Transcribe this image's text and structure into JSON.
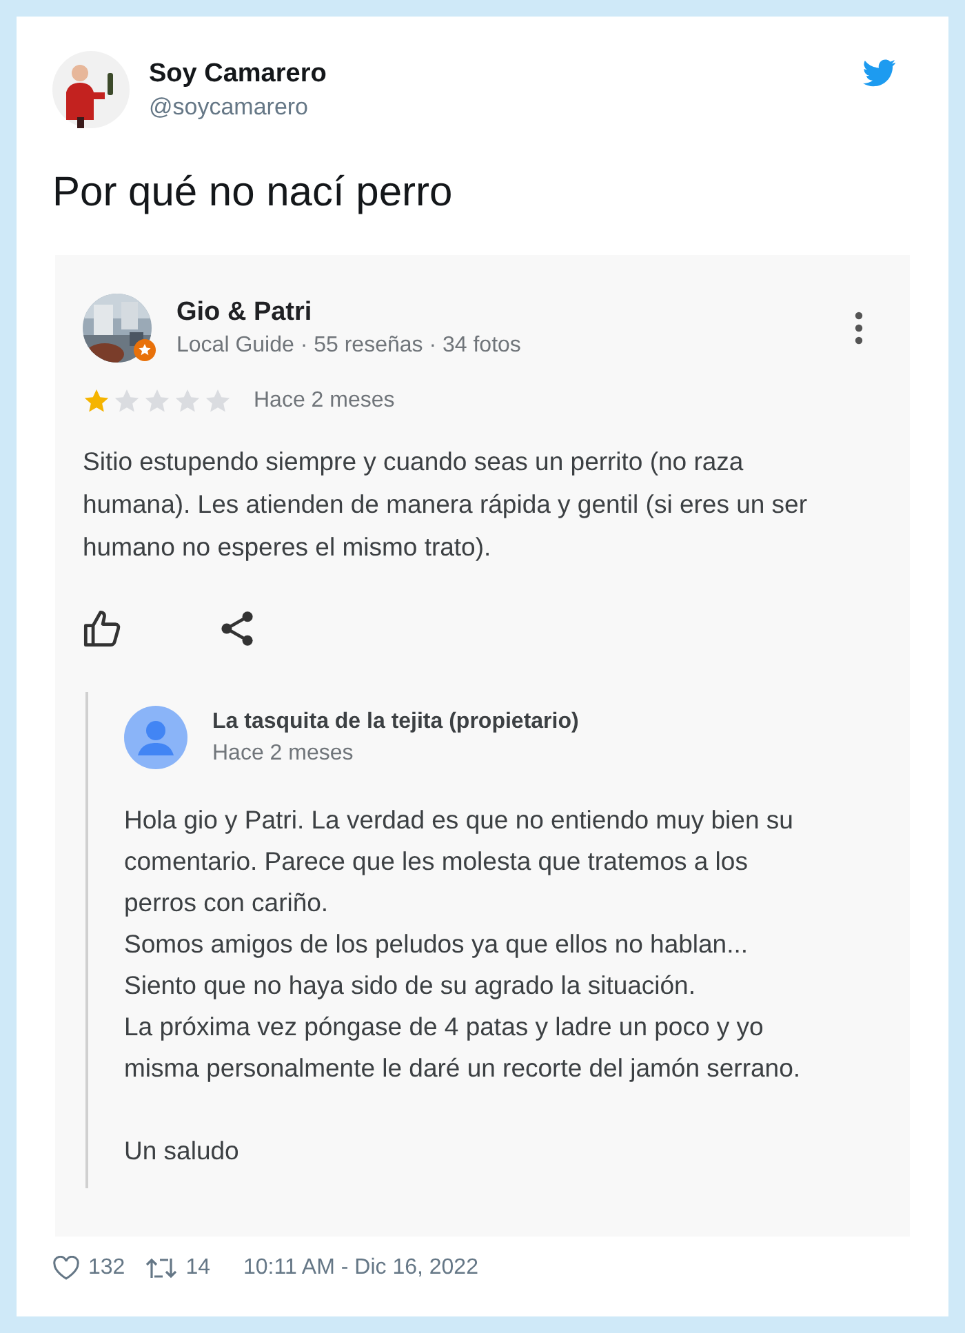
{
  "tweet": {
    "name": "Soy Camarero",
    "handle": "@soycamarero",
    "text": "Por qué no nací perro",
    "review": {
      "author": "Gio & Patri",
      "meta": "Local Guide · 55 reseñas · 34 fotos",
      "stars": 1,
      "time": "Hace 2 meses",
      "text": "Sitio estupendo siempre y cuando seas un perrito (no raza humana). Les atienden de manera rápida y gentil (si eres un ser humano no esperes el mismo trato).",
      "reply": {
        "author": "La tasquita de la tejita (propietario)",
        "time": "Hace 2 meses",
        "paragraphs": [
          "Hola gio y Patri. La verdad es que no entiendo muy bien su comentario. Parece que les molesta que tratemos a los perros con cariño.",
          "Somos amigos de los peludos ya que ellos no hablan...",
          "Siento que no haya sido de su agrado la situación.",
          "La próxima vez póngase de 4 patas y ladre un poco y yo misma personalmente le daré un recorte del jamón serrano."
        ],
        "closing": "Un saludo"
      }
    },
    "likes": "132",
    "retweets": "14",
    "timestamp": "10:11 AM - Dic 16, 2022"
  }
}
